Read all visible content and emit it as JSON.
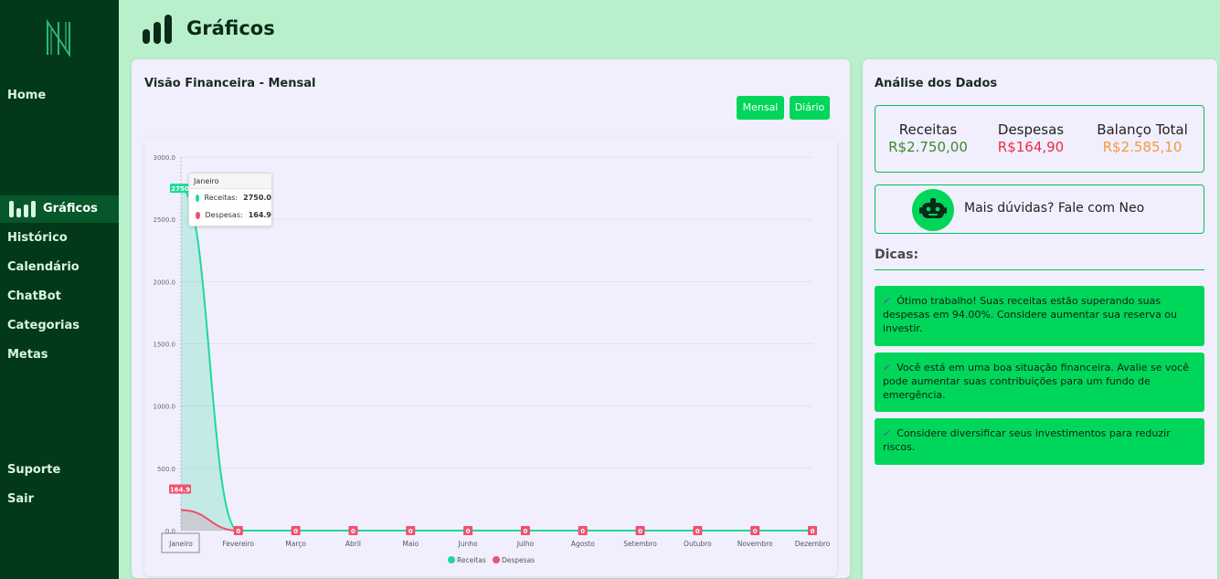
{
  "sidebar": {
    "items": [
      {
        "label": "Home"
      },
      {
        "label": "Gráficos",
        "active": true
      },
      {
        "label": "Histórico"
      },
      {
        "label": "Calendário"
      },
      {
        "label": "ChatBot"
      },
      {
        "label": "Categorias"
      },
      {
        "label": "Metas"
      },
      {
        "label": "Suporte"
      },
      {
        "label": "Sair"
      }
    ]
  },
  "header": {
    "title": "Gráficos",
    "icon": "bar-chart-icon"
  },
  "chart_card": {
    "title": "Visão Financeira - Mensal",
    "buttons": {
      "mensal": "Mensal",
      "diario": "Diário"
    },
    "tooltip": {
      "title": "Janeiro",
      "receitas_label": "Receitas:",
      "receitas_value": "2750.0",
      "despesas_label": "Despesas:",
      "despesas_value": "164.9"
    }
  },
  "chart_data": {
    "type": "area",
    "categories": [
      "Janeiro",
      "Fevereiro",
      "Março",
      "Abril",
      "Maio",
      "Junho",
      "Julho",
      "Agosto",
      "Setembro",
      "Outubro",
      "Novembro",
      "Dezembro"
    ],
    "series": [
      {
        "name": "Receitas",
        "values": [
          2750,
          0,
          0,
          0,
          0,
          0,
          0,
          0,
          0,
          0,
          0,
          0
        ],
        "color": "#1fd99a"
      },
      {
        "name": "Despesas",
        "values": [
          164.9,
          0,
          0,
          0,
          0,
          0,
          0,
          0,
          0,
          0,
          0,
          0
        ],
        "color": "#f0506e"
      }
    ],
    "data_labels": {
      "receitas": [
        "2750",
        "0",
        "0",
        "0",
        "0",
        "0",
        "0",
        "0",
        "0",
        "0",
        "0",
        "0"
      ],
      "despesas": [
        "164.9",
        "0",
        "0",
        "0",
        "0",
        "0",
        "0",
        "0",
        "0",
        "0",
        "0",
        "0"
      ]
    },
    "y_ticks": [
      "0.0",
      "500.0",
      "1000.0",
      "1500.0",
      "2000.0",
      "2500.0",
      "3000.0"
    ],
    "ylim": [
      0,
      3000
    ],
    "grid": true,
    "legend": "bottom",
    "title": "",
    "xlabel": "",
    "ylabel": ""
  },
  "analysis": {
    "title": "Análise dos Dados",
    "receitas_label": "Receitas",
    "receitas_value": "R$2.750,00",
    "despesas_label": "Despesas",
    "despesas_value": "R$164,90",
    "balanco_label": "Balanço Total",
    "balanco_value": "R$2.585,10",
    "colors": {
      "receitas": "#3a8a2e",
      "despesas": "#ee2d3f",
      "balanco": "#f59a3c"
    },
    "neo_text": "Mais dúvidas? Fale com Neo",
    "tips_title": "Dicas:",
    "tips": [
      "Ótimo trabalho! Suas receitas estão superando suas despesas em 94.00%. Considere aumentar sua reserva ou investir.",
      "Você está em uma boa situação financeira. Avalie se você pode aumentar suas contribuições para um fundo de emergência.",
      "Considere diversificar seus investimentos para reduzir riscos."
    ]
  }
}
